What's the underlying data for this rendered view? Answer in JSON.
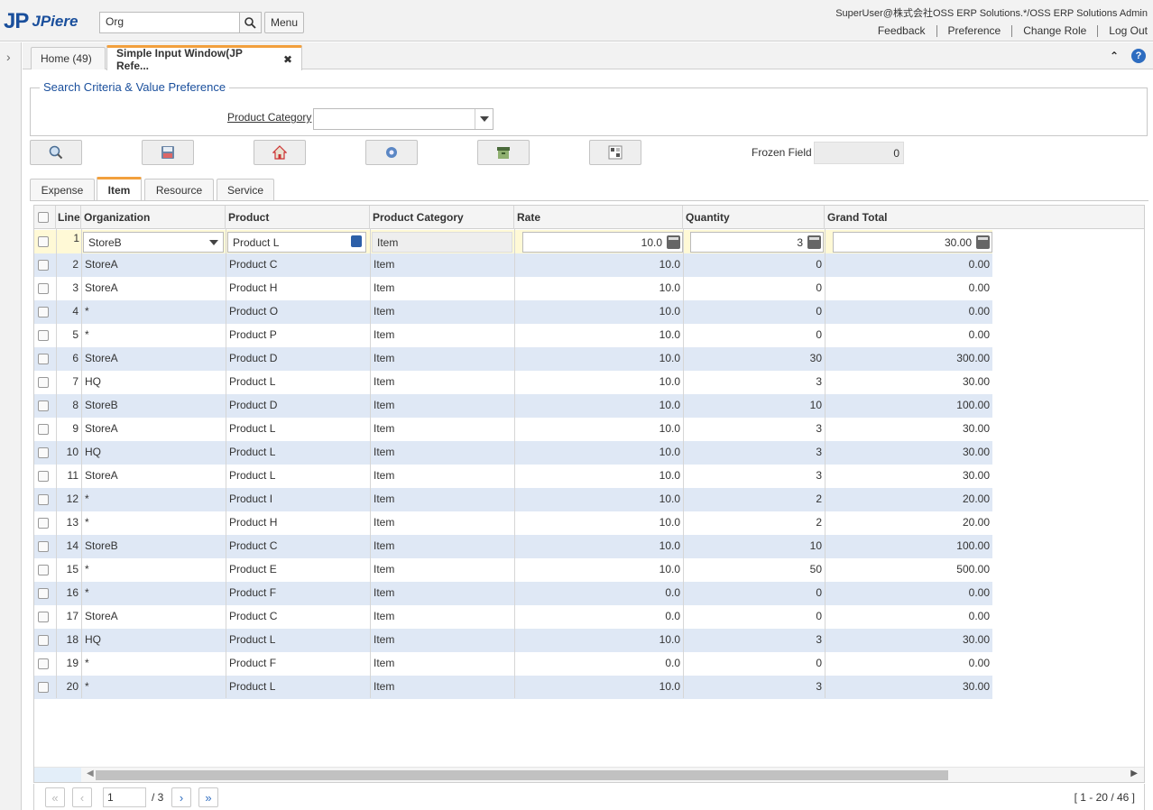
{
  "header": {
    "logo_mark": "JP",
    "logo_text": "JPiere",
    "search_value": "Org",
    "menu_label": "Menu",
    "user_info": "SuperUser@株式会社OSS ERP Solutions.*/OSS ERP Solutions Admin",
    "links": [
      "Feedback",
      "Preference",
      "Change Role",
      "Log Out"
    ]
  },
  "window_tabs": {
    "home": "Home (49)",
    "active": "Simple Input Window(JP Refe...",
    "close": "✖"
  },
  "criteria": {
    "legend": "Search Criteria & Value Preference",
    "product_category_label": "Product Category",
    "product_category_value": ""
  },
  "toolbar": {
    "buttons": [
      "search-icon",
      "save-icon",
      "home-icon",
      "process-icon",
      "archive-icon",
      "grid-toggle-icon"
    ],
    "frozen_label": "Frozen Field",
    "frozen_value": "0"
  },
  "detail_tabs": [
    "Expense",
    "Item",
    "Resource",
    "Service"
  ],
  "active_detail_tab": "Item",
  "grid": {
    "columns": [
      "Line",
      "Organization",
      "Product",
      "Product Category",
      "Rate",
      "Quantity",
      "Grand Total"
    ],
    "edit_row": {
      "line": "1",
      "organization": "StoreB",
      "product": "Product L",
      "category": "Item",
      "rate": "10.0",
      "quantity": "3",
      "total": "30.00"
    },
    "rows": [
      [
        "2",
        "StoreA",
        "Product C",
        "Item",
        "10.0",
        "0",
        "0.00"
      ],
      [
        "3",
        "StoreA",
        "Product H",
        "Item",
        "10.0",
        "0",
        "0.00"
      ],
      [
        "4",
        "*",
        "Product O",
        "Item",
        "10.0",
        "0",
        "0.00"
      ],
      [
        "5",
        "*",
        "Product P",
        "Item",
        "10.0",
        "0",
        "0.00"
      ],
      [
        "6",
        "StoreA",
        "Product D",
        "Item",
        "10.0",
        "30",
        "300.00"
      ],
      [
        "7",
        "HQ",
        "Product L",
        "Item",
        "10.0",
        "3",
        "30.00"
      ],
      [
        "8",
        "StoreB",
        "Product D",
        "Item",
        "10.0",
        "10",
        "100.00"
      ],
      [
        "9",
        "StoreA",
        "Product L",
        "Item",
        "10.0",
        "3",
        "30.00"
      ],
      [
        "10",
        "HQ",
        "Product L",
        "Item",
        "10.0",
        "3",
        "30.00"
      ],
      [
        "11",
        "StoreA",
        "Product L",
        "Item",
        "10.0",
        "3",
        "30.00"
      ],
      [
        "12",
        "*",
        "Product I",
        "Item",
        "10.0",
        "2",
        "20.00"
      ],
      [
        "13",
        "*",
        "Product H",
        "Item",
        "10.0",
        "2",
        "20.00"
      ],
      [
        "14",
        "StoreB",
        "Product C",
        "Item",
        "10.0",
        "10",
        "100.00"
      ],
      [
        "15",
        "*",
        "Product E",
        "Item",
        "10.0",
        "50",
        "500.00"
      ],
      [
        "16",
        "*",
        "Product F",
        "Item",
        "0.0",
        "0",
        "0.00"
      ],
      [
        "17",
        "StoreA",
        "Product C",
        "Item",
        "0.0",
        "0",
        "0.00"
      ],
      [
        "18",
        "HQ",
        "Product L",
        "Item",
        "10.0",
        "3",
        "30.00"
      ],
      [
        "19",
        "*",
        "Product F",
        "Item",
        "0.0",
        "0",
        "0.00"
      ],
      [
        "20",
        "*",
        "Product L",
        "Item",
        "10.0",
        "3",
        "30.00"
      ]
    ]
  },
  "pager": {
    "first": "«",
    "prev": "‹",
    "page": "1",
    "total": "/ 3",
    "next": "›",
    "last": "»",
    "range": "[ 1 - 20 / 46 ]"
  },
  "colors": {
    "brand": "#1a4f9c",
    "active_tab": "#f2a03d",
    "row_alt": "#dfe8f5",
    "edit_row": "#fff9d6"
  }
}
